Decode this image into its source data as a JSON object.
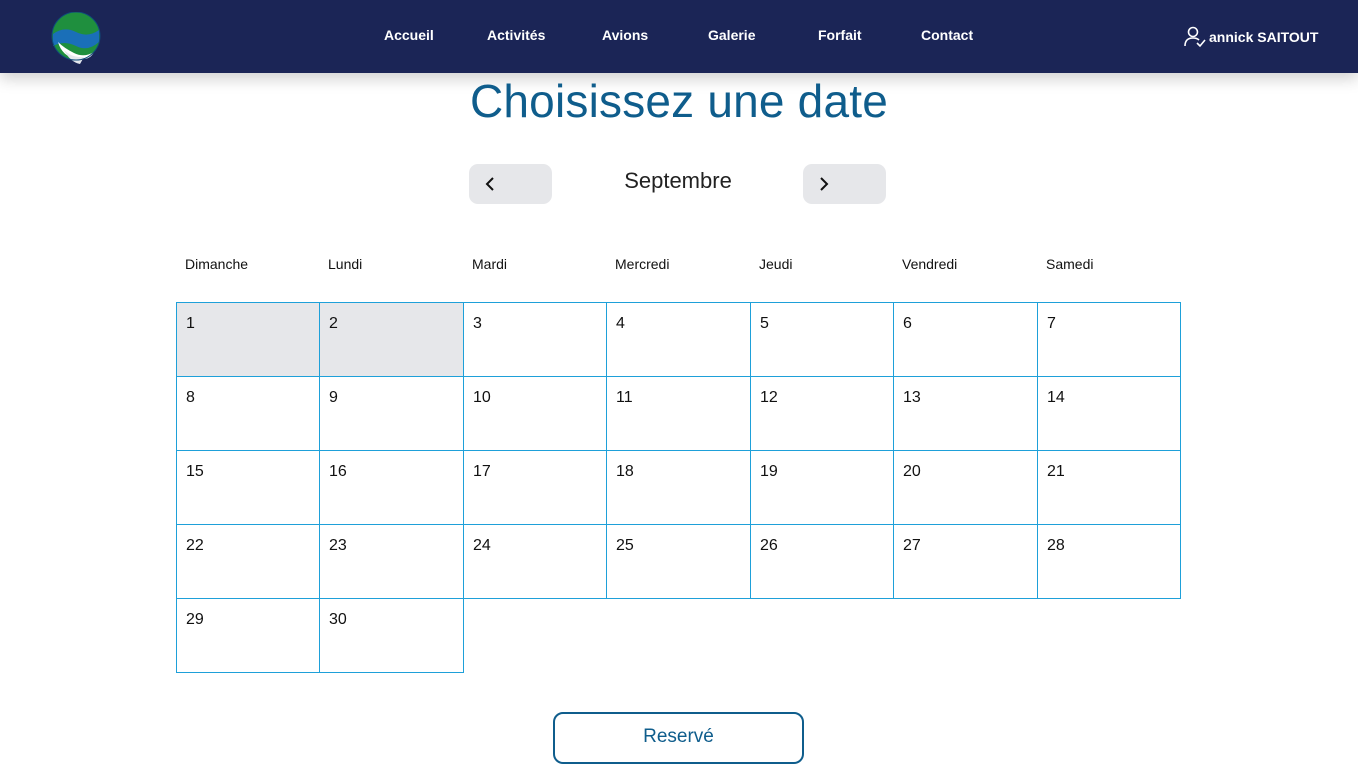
{
  "nav": {
    "logo_name": "logo-icon",
    "items": [
      "Accueil",
      "Activités",
      "Avions",
      "Galerie",
      "Forfait",
      "Contact"
    ],
    "user_name": "annick SAITOUT"
  },
  "calendar": {
    "title": "Choisissez une date",
    "month": "Septembre",
    "weekdays": [
      "Dimanche",
      "Lundi",
      "Mardi",
      "Mercredi",
      "Jeudi",
      "Vendredi",
      "Samedi"
    ],
    "days": [
      "1",
      "2",
      "3",
      "4",
      "5",
      "6",
      "7",
      "8",
      "9",
      "10",
      "11",
      "12",
      "13",
      "14",
      "15",
      "16",
      "17",
      "18",
      "19",
      "20",
      "21",
      "22",
      "23",
      "24",
      "25",
      "26",
      "27",
      "28",
      "29",
      "30"
    ],
    "past_days": [
      "1",
      "2"
    ],
    "reserve_label": "Reservé"
  },
  "colors": {
    "navbar": "#1b2556",
    "title": "#0f5d8c",
    "cell_border": "#1ea0d9",
    "past_cell": "#e6e7ea"
  }
}
